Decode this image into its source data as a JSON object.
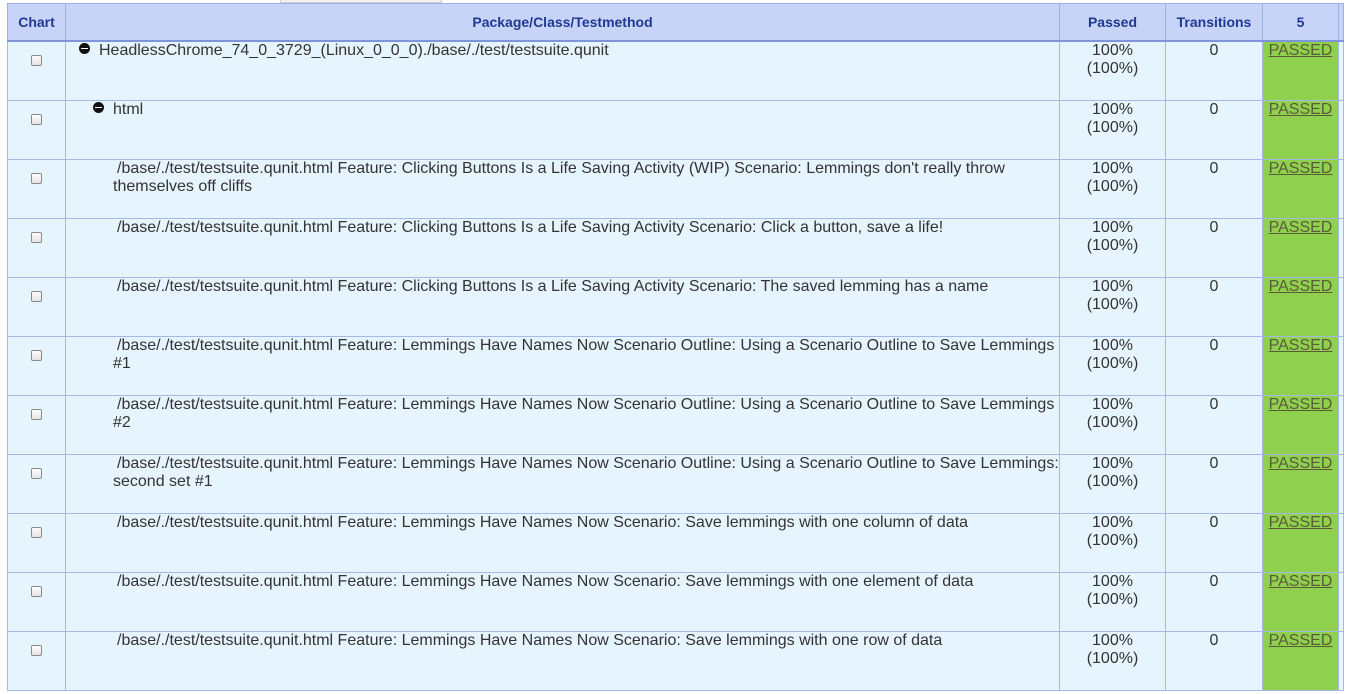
{
  "headers": {
    "chart": "Chart",
    "name": "Package/Class/Testmethod",
    "passed": "Passed",
    "transitions": "Transitions",
    "run": "5"
  },
  "rows": [
    {
      "level": 0,
      "toggle": "collapse",
      "name": "HeadlessChrome_74_0_3729_(Linux_0_0_0)./base/./test/testsuite.qunit",
      "passed_pct": "100%",
      "passed_sub": "(100%)",
      "transitions": "0",
      "status": "PASSED"
    },
    {
      "level": 1,
      "toggle": "collapse",
      "name": "html",
      "passed_pct": "100%",
      "passed_sub": "(100%)",
      "transitions": "0",
      "status": "PASSED"
    },
    {
      "level": 2,
      "toggle": "",
      "name": "/base/./test/testsuite.qunit.html Feature: Clicking Buttons Is a Life Saving Activity (WIP) Scenario: Lemmings don't really throw themselves off cliffs",
      "passed_pct": "100%",
      "passed_sub": "(100%)",
      "transitions": "0",
      "status": "PASSED"
    },
    {
      "level": 2,
      "toggle": "",
      "name": "/base/./test/testsuite.qunit.html Feature: Clicking Buttons Is a Life Saving Activity Scenario: Click a button, save a life!",
      "passed_pct": "100%",
      "passed_sub": "(100%)",
      "transitions": "0",
      "status": "PASSED"
    },
    {
      "level": 2,
      "toggle": "",
      "name": "/base/./test/testsuite.qunit.html Feature: Clicking Buttons Is a Life Saving Activity Scenario: The saved lemming has a name",
      "passed_pct": "100%",
      "passed_sub": "(100%)",
      "transitions": "0",
      "status": "PASSED"
    },
    {
      "level": 2,
      "toggle": "",
      "name": "/base/./test/testsuite.qunit.html Feature: Lemmings Have Names Now Scenario Outline: Using a Scenario Outline to Save Lemmings #1",
      "passed_pct": "100%",
      "passed_sub": "(100%)",
      "transitions": "0",
      "status": "PASSED"
    },
    {
      "level": 2,
      "toggle": "",
      "name": "/base/./test/testsuite.qunit.html Feature: Lemmings Have Names Now Scenario Outline: Using a Scenario Outline to Save Lemmings #2",
      "passed_pct": "100%",
      "passed_sub": "(100%)",
      "transitions": "0",
      "status": "PASSED"
    },
    {
      "level": 2,
      "toggle": "",
      "name": "/base/./test/testsuite.qunit.html Feature: Lemmings Have Names Now Scenario Outline: Using a Scenario Outline to Save Lemmings: second set #1",
      "passed_pct": "100%",
      "passed_sub": "(100%)",
      "transitions": "0",
      "status": "PASSED"
    },
    {
      "level": 2,
      "toggle": "",
      "name": "/base/./test/testsuite.qunit.html Feature: Lemmings Have Names Now Scenario: Save lemmings with one column of data",
      "passed_pct": "100%",
      "passed_sub": "(100%)",
      "transitions": "0",
      "status": "PASSED"
    },
    {
      "level": 2,
      "toggle": "",
      "name": "/base/./test/testsuite.qunit.html Feature: Lemmings Have Names Now Scenario: Save lemmings with one element of data",
      "passed_pct": "100%",
      "passed_sub": "(100%)",
      "transitions": "0",
      "status": "PASSED"
    },
    {
      "level": 2,
      "toggle": "",
      "name": "/base/./test/testsuite.qunit.html Feature: Lemmings Have Names Now Scenario: Save lemmings with one row of data",
      "passed_pct": "100%",
      "passed_sub": "(100%)",
      "transitions": "0",
      "status": "PASSED"
    }
  ],
  "colors": {
    "header_bg": "#c7d3f7",
    "header_text": "#1f3a93",
    "row_bg": "#e6f4fd",
    "status_bg": "#8fd14f"
  },
  "icons": {
    "collapse": "minus-circle-icon",
    "select": "checkbox"
  }
}
